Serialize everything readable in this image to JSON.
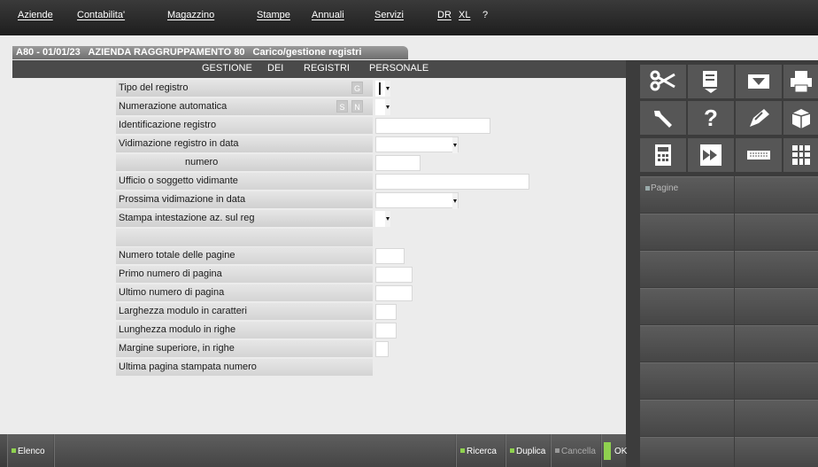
{
  "menu": [
    "Aziende",
    "Contabilita'",
    "Magazzino",
    "Stampe",
    "Annuali",
    "Servizi",
    "DR",
    "XL",
    "?"
  ],
  "window": {
    "code": "A80 - 01/01/23",
    "company": "AZIENDA RAGGRUPPAMENTO 80",
    "title": "Carico/gestione registri"
  },
  "header": {
    "w1": "GESTIONE",
    "w2": "DEI",
    "w3": "REGISTRI",
    "w4": "PERSONALE"
  },
  "form": {
    "tipo_registro": {
      "label": "Tipo del registro",
      "badge": "G"
    },
    "numerazione": {
      "label": "Numerazione automatica",
      "badge_s": "S",
      "badge_n": "N"
    },
    "identificazione": {
      "label": "Identificazione registro"
    },
    "vidimazione": {
      "label": "Vidimazione registro in data"
    },
    "numero": {
      "label": "numero"
    },
    "ufficio": {
      "label": "Ufficio o soggetto vidimante"
    },
    "prossima": {
      "label": "Prossima vidimazione in data"
    },
    "stampa_intestazione": {
      "label": "Stampa intestazione az. sul reg"
    },
    "numero_totale": {
      "label": "Numero totale delle pagine"
    },
    "primo_numero": {
      "label": "Primo numero di pagina"
    },
    "ultimo_numero": {
      "label": "Ultimo numero di pagina"
    },
    "larghezza": {
      "label": "Larghezza modulo in caratteri"
    },
    "lunghezza": {
      "label": "Lunghezza modulo in righe"
    },
    "margine": {
      "label": "Margine superiore, in righe"
    },
    "ultima_pagina": {
      "label": "Ultima pagina stampata numero"
    }
  },
  "sidebar": {
    "icons": [
      "scissors-icon",
      "document-icon",
      "inbox-icon",
      "printer-icon",
      "wrench-icon",
      "help-icon",
      "edit-icon",
      "box-f-icon",
      "calculator-icon",
      "transfer-icon",
      "keyboard-icon",
      "grid-icon"
    ],
    "help_glyph": "?",
    "pagine_label": "Pagine"
  },
  "bottom": {
    "elenco": "Elenco",
    "ricerca": "Ricerca",
    "duplica": "Duplica",
    "cancella": "Cancella",
    "ok": "OK"
  },
  "colors": {
    "accent_green": "#8fd14f",
    "dark_bar": "#3c3c3c"
  }
}
